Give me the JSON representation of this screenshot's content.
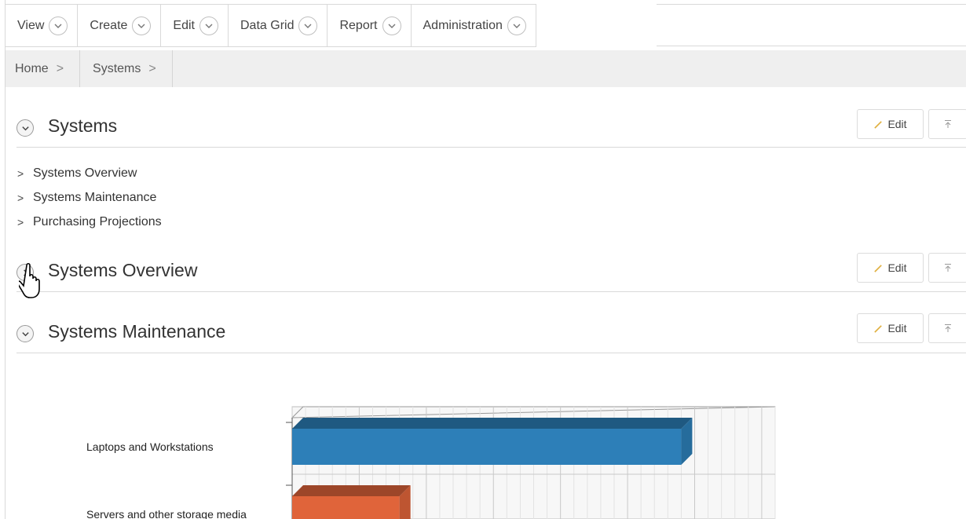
{
  "menu": {
    "items": [
      {
        "label": "View"
      },
      {
        "label": "Create"
      },
      {
        "label": "Edit"
      },
      {
        "label": "Data Grid"
      },
      {
        "label": "Report"
      },
      {
        "label": "Administration"
      }
    ]
  },
  "breadcrumb": {
    "items": [
      {
        "label": "Home"
      },
      {
        "label": "Systems"
      }
    ]
  },
  "regions": {
    "systems": {
      "title": "Systems",
      "edit_label": "Edit"
    },
    "overview": {
      "title": "Systems Overview",
      "edit_label": "Edit"
    },
    "maintenance": {
      "title": "Systems Maintenance",
      "edit_label": "Edit"
    }
  },
  "sub_list": [
    {
      "label": "Systems Overview"
    },
    {
      "label": "Systems Maintenance"
    },
    {
      "label": "Purchasing Projections"
    }
  ],
  "chart_data": {
    "type": "bar",
    "orientation": "horizontal",
    "categories": [
      "Laptops and Workstations",
      "Servers and other storage media"
    ],
    "values": [
      58,
      16
    ],
    "xlim": [
      0,
      72
    ],
    "colors": [
      "#2d7fb8",
      "#e0643a"
    ],
    "grid": true
  },
  "colors": {
    "accent": "#2d7fb8",
    "secondary": "#e0643a"
  }
}
